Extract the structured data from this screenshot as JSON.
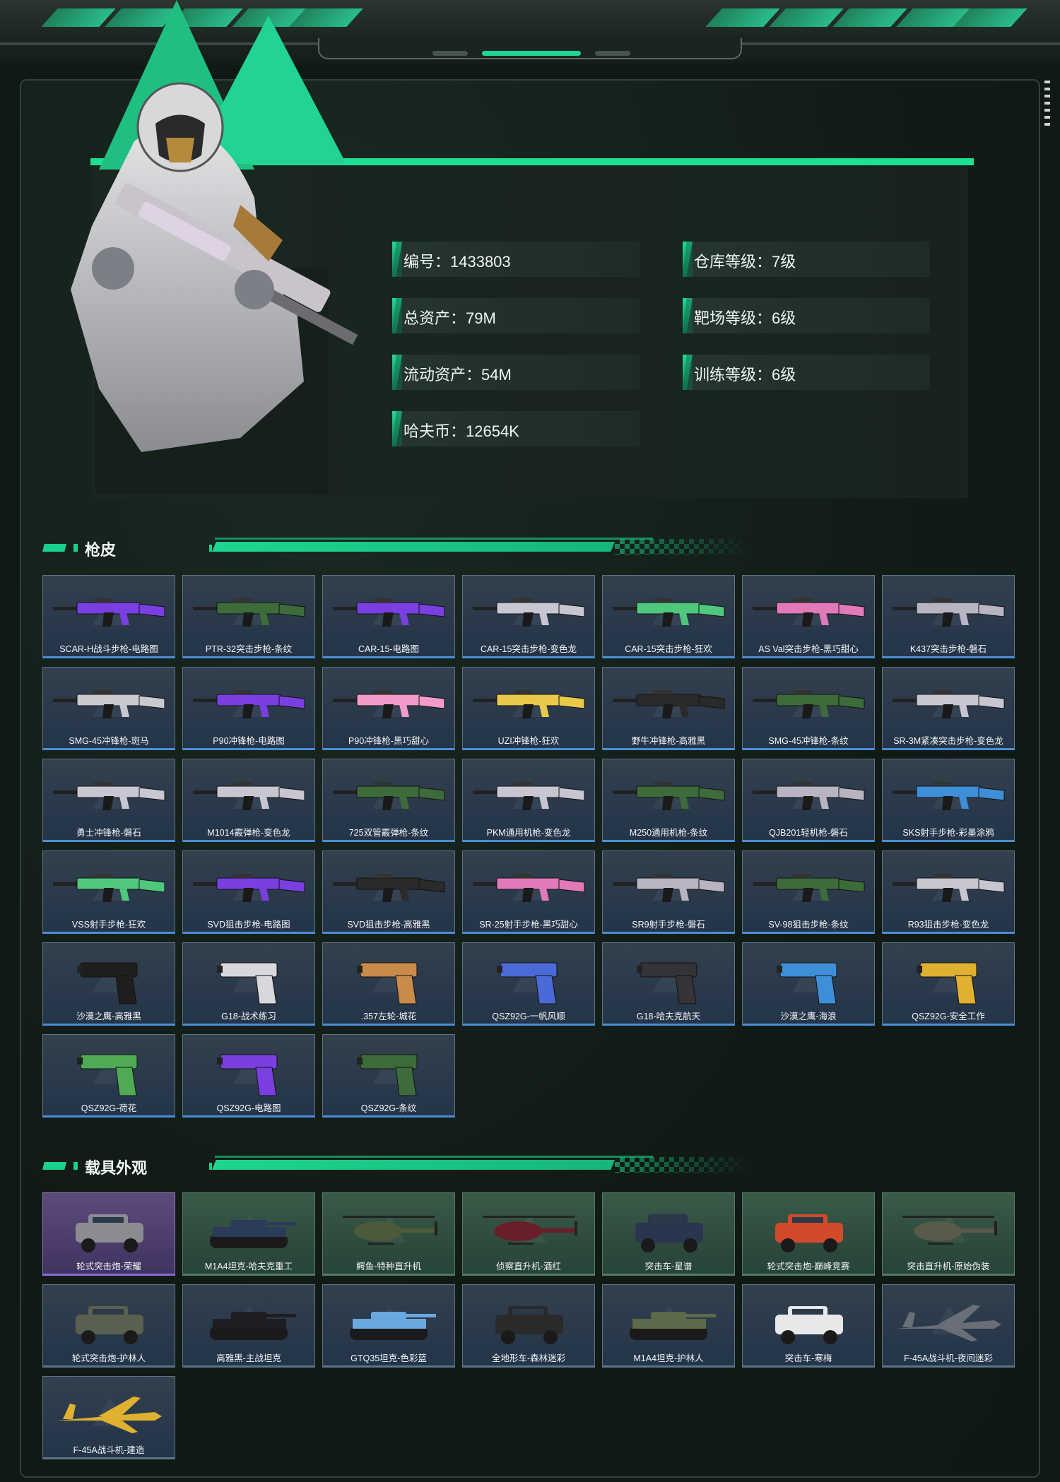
{
  "profile": {
    "stats_left": [
      "编号：1433803",
      "总资产：79M",
      "流动资产：54M",
      "哈夫币：12654K"
    ],
    "stats_right": [
      "仓库等级：7级",
      "靶场等级：6级",
      "训练等级：6级"
    ]
  },
  "sections": {
    "gun_skins": {
      "title": "枪皮",
      "items": [
        "SCAR-H战斗步枪-电路图",
        "PTR-32突击步枪-条纹",
        "CAR-15-电路图",
        "CAR-15突击步枪-变色龙",
        "CAR-15突击步枪-狂欢",
        "AS Val突击步枪-黑巧甜心",
        "K437突击步枪-磐石",
        "SMG-45冲锋枪-斑马",
        "P90冲锋枪-电路图",
        "P90冲锋枪-黑巧甜心",
        "UZI冲锋枪-狂欢",
        "野牛冲锋枪-高雅黑",
        "SMG-45冲锋枪-条纹",
        "SR-3M紧凑突击步枪-变色龙",
        "勇士冲锋枪-磐石",
        "M1014霰弹枪-变色龙",
        "725双管霰弹枪-条纹",
        "PKM通用机枪-变色龙",
        "M250通用机枪-条纹",
        "QJB201轻机枪-磐石",
        "SKS射手步枪-彩墨涂鸦",
        "VSS射手步枪-狂欢",
        "SVD狙击步枪-电路图",
        "SVD狙击步枪-高雅黑",
        "SR-25射手步枪-黑巧甜心",
        "SR9射手步枪-磐石",
        "SV-98狙击步枪-条纹",
        "R93狙击步枪-变色龙",
        "沙漠之鹰-高雅黑",
        "G18-战术练习",
        ".357左轮-城花",
        "QSZ92G-一帆风顺",
        "G18-哈夫克航天",
        "沙漠之鹰-海浪",
        "QSZ92G-安全工作",
        "QSZ92G-荷花",
        "QSZ92G-电路图",
        "QSZ92G-条纹"
      ]
    },
    "vehicles": {
      "title": "载具外观",
      "items": [
        "轮式突击炮-荣耀",
        "M1A4坦克-哈夫克重工",
        "鳄鱼-特种直升机",
        "侦察直升机-酒红",
        "突击车-星谱",
        "轮式突击炮-巅峰竞赛",
        "突击直升机-原始伪装",
        "轮式突击炮-护林人",
        "高雅黑-主战坦克",
        "GTQ35坦克-色彩蓝",
        "全地形车-森林迷彩",
        "M1A4坦克-护林人",
        "突击车-寒梅",
        "F-45A战斗机-夜间迷彩",
        "F-45A战斗机-建造"
      ]
    }
  },
  "colors": {
    "accent": "#1de090",
    "card_bg": "#2a3a4b",
    "vehicle_bg": "#2f4b3d"
  }
}
